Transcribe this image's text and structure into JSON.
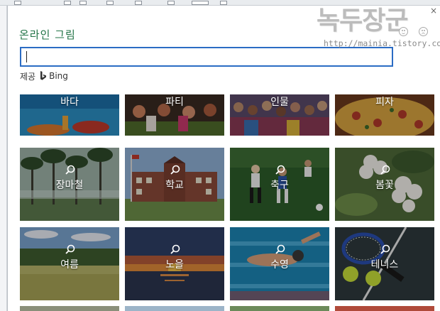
{
  "dialog": {
    "title": "온라인 그림",
    "search": {
      "value": "",
      "placeholder": ""
    },
    "provider_label": "제공",
    "provider_name": "Bing",
    "close_icon": "close-icon"
  },
  "watermark": {
    "title": "녹두장군",
    "url": "http://mainia.tistory.com"
  },
  "categories_row1": [
    {
      "label": "바다"
    },
    {
      "label": "파티"
    },
    {
      "label": "인물"
    },
    {
      "label": "피자"
    }
  ],
  "categories_row2": [
    {
      "label": "장마철"
    },
    {
      "label": "학교"
    },
    {
      "label": "축구"
    },
    {
      "label": "봄꽃"
    }
  ],
  "categories_row3": [
    {
      "label": "여름"
    },
    {
      "label": "노을"
    },
    {
      "label": "수영"
    },
    {
      "label": "테니스"
    }
  ],
  "colors": {
    "title_green": "#217346",
    "search_border_blue": "#2b6cc4"
  }
}
